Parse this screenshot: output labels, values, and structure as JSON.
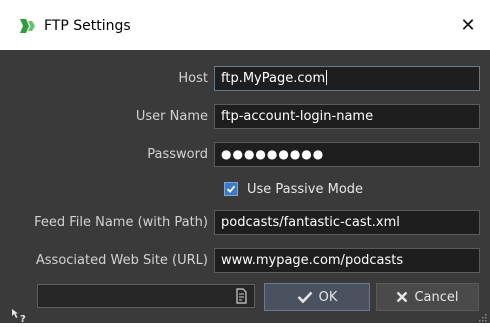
{
  "window": {
    "title": "FTP Settings",
    "close_glyph": "✕",
    "icon": "app-logo-icon"
  },
  "form": {
    "host_label": "Host",
    "host_value": "ftp.MyPage.com",
    "username_label": "User Name",
    "username_value": "ftp-account-login-name",
    "password_label": "Password",
    "password_value": "●●●●●●●●●",
    "passive_label": "Use Passive Mode",
    "passive_checked": true,
    "feed_label": "Feed File Name (with Path)",
    "feed_value": "podcasts/fantastic-cast.xml",
    "website_label": "Associated Web Site (URL)",
    "website_value": "www.mypage.com/podcasts"
  },
  "footer": {
    "path_value": "",
    "ok_label": "OK",
    "cancel_label": "Cancel",
    "help_icon": "whats-this-help-icon",
    "file_icon": "file-browse-icon"
  },
  "colors": {
    "background": "#3a3a3a",
    "field_bg": "#1e1e1e",
    "accent": "#3e79c4",
    "logo_green": "#2e9e3e"
  }
}
